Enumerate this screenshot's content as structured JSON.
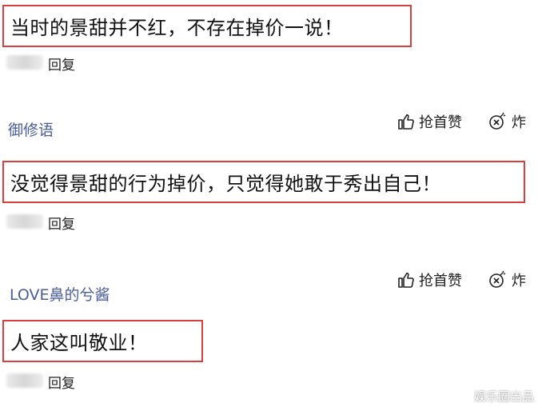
{
  "comments": [
    {
      "text": "当时的景甜并不红，不存在掉价一说！",
      "reply_label": "回复"
    },
    {
      "username": "御修语",
      "like_label": "抢首赞",
      "bomb_label": "炸",
      "text": "没觉得景甜的行为掉价，只觉得她敢于秀出自己！",
      "reply_label": "回复"
    },
    {
      "username": "LOVE鼻的兮酱",
      "like_label": "抢首赞",
      "bomb_label": "炸",
      "text": "人家这叫敬业！",
      "reply_label": "回复"
    }
  ],
  "watermark": "娱乐圈出品",
  "colors": {
    "highlight_border": "#d8403f",
    "username": "#4a5e9a"
  },
  "icons": {
    "like": "thumbs-up-icon",
    "bomb": "bomb-icon"
  }
}
